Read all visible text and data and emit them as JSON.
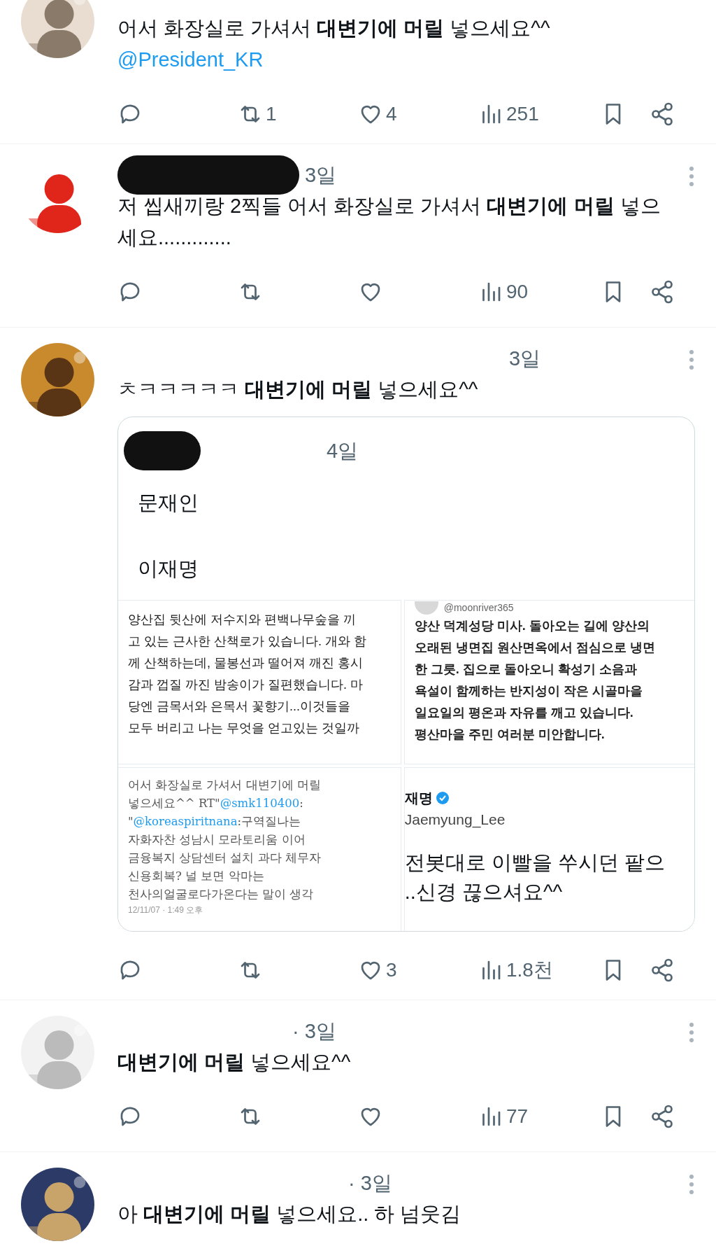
{
  "tweets": [
    {
      "text": "어서 화장실로 가셔서 **대변기에 머릴** 넣으세요^^",
      "mention": "@President_KR",
      "actions": {
        "retweets": "1",
        "likes": "4",
        "views": "251"
      }
    },
    {
      "time": "3일",
      "text": "저 씹새끼랑 2찍들 어서 화장실로 가셔서 **대변기에 머릴** 넣으세요.............",
      "actions": {
        "views": "90"
      }
    },
    {
      "time": "3일",
      "text": "ㅊㅋㅋㅋㅋㅋ **대변기에 머릴** 넣으세요^^",
      "actions": {
        "likes": "3",
        "views": "1.8천"
      },
      "quote": {
        "time": "4일",
        "lines": [
          "문재인",
          "이재명"
        ],
        "images": [
          {
            "kind": "post",
            "lines": [
              "양산집 뒷산에  저수지와 편백나무숲을 끼",
              "고 있는 근사한 산책로가 있습니다. 개와 함",
              "께 산책하는데, 물봉선과 떨어져 깨진 홍시",
              "감과 껍질 까진 밤송이가 질편했습니다. 마",
              "당엔  금목서와 은목서 꽃향기...이것들을",
              "모두 버리고 나는 무엇을 얻고있는 것일까"
            ]
          },
          {
            "kind": "tweet",
            "handle": "@moonriver365",
            "lines": [
              "양산 덕계성당 미사. 돌아오는 길에 양산의",
              "오래된 냉면집 원산면옥에서 점심으로 냉면",
              "한 그릇. 집으로 돌아오니 확성기 소음과",
              "욕설이 함께하는 반지성이 작은 시골마을",
              "일요일의 평온과 자유를 깨고 있습니다.",
              "평산마을 주민 여러분 미안합니다."
            ]
          },
          {
            "kind": "post",
            "lines": [
              "어서 화장실로 가셔서 대변기에 머릴",
              [
                {
                  "text": "넣으세요^^ RT\"",
                  "kind": "plain"
                },
                {
                  "text": "@smk110400",
                  "kind": "mention"
                },
                {
                  "text": ":",
                  "kind": "plain"
                }
              ],
              [
                {
                  "text": "\"",
                  "kind": "plain"
                },
                {
                  "text": "@koreaspiritnana",
                  "kind": "mention"
                },
                {
                  "text": ":구역질나는",
                  "kind": "plain"
                }
              ],
              "자화자찬 성남시 모라토리움 이어",
              "금융복지 상담센터 설치 과다 체무자",
              "신용회복? 널 보면 악마는",
              "천사의얼굴로다가온다는 말이 생각"
            ],
            "date": "12/11/07 · 1:49 오후"
          },
          {
            "kind": "profile",
            "name": "재명",
            "verified": true,
            "handle": "Jaemyung_Lee",
            "lines": [
              "전봇대로 이빨을 쑤시던 팥으",
              "..신경 끊으셔요^^"
            ]
          }
        ]
      }
    },
    {
      "time": "· 3일",
      "text": "**대변기에 머릴** 넣으세요^^",
      "actions": {
        "views": "77"
      }
    },
    {
      "time": "· 3일",
      "text": "아 **대변기에 머릴** 넣으세요.. 하 넘웃김"
    }
  ]
}
